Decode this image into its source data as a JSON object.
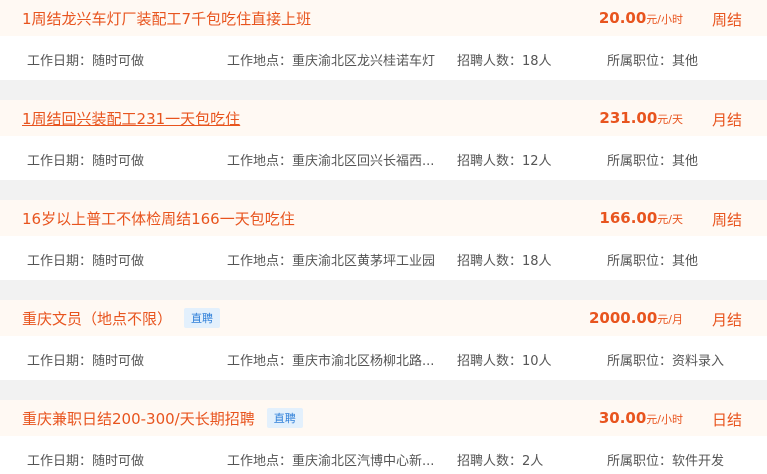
{
  "labels": {
    "date": "工作日期：",
    "location": "工作地点：",
    "count": "招聘人数：",
    "position": "所属职位："
  },
  "jobs": [
    {
      "title": "1周结龙兴车灯厂装配工7千包吃住直接上班",
      "badge": "",
      "salary": "20.00",
      "unit": "元/小时",
      "cycle": "周结",
      "date": "随时可做",
      "location": "重庆渝北区龙兴桂诺车灯",
      "count": "18人",
      "position": "其他",
      "underlined": false
    },
    {
      "title": "1周结回兴装配工231一天包吃住",
      "badge": "",
      "salary": "231.00",
      "unit": "元/天",
      "cycle": "月结",
      "date": "随时可做",
      "location": "重庆渝北区回兴长福西...",
      "count": "12人",
      "position": "其他",
      "underlined": true
    },
    {
      "title": "16岁以上普工不体检周结166一天包吃住",
      "badge": "",
      "salary": "166.00",
      "unit": "元/天",
      "cycle": "周结",
      "date": "随时可做",
      "location": "重庆渝北区黄茅坪工业园",
      "count": "18人",
      "position": "其他",
      "underlined": false
    },
    {
      "title": "重庆文员（地点不限）",
      "badge": "直聘",
      "salary": "2000.00",
      "unit": "元/月",
      "cycle": "月结",
      "date": "随时可做",
      "location": "重庆市渝北区杨柳北路...",
      "count": "10人",
      "position": "资料录入",
      "underlined": false
    },
    {
      "title": "重庆兼职日结200-300/天长期招聘",
      "badge": "直聘",
      "salary": "30.00",
      "unit": "元/小时",
      "cycle": "日结",
      "date": "随时可做",
      "location": "重庆渝北区汽博中心新...",
      "count": "2人",
      "position": "软件开发",
      "underlined": false
    }
  ]
}
